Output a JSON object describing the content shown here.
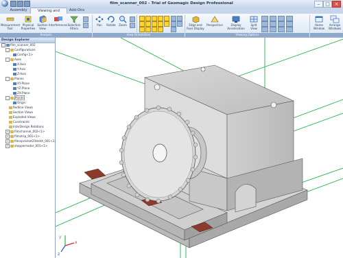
{
  "window": {
    "title": "film_scanner_002 - Trial of Geomagic Design Professional"
  },
  "tabs": [
    "Assembly",
    "Viewing and Analysis",
    "Add-Ons"
  ],
  "ribbon": {
    "groups": {
      "analysis": "Analysis",
      "view_orientation": "View Orientation",
      "viewing_options": "Viewing Options"
    },
    "buttons": {
      "measurement_tool": "Measurement Tool",
      "physical_properties": "Physical Properties",
      "section_view": "Section View",
      "interferences": "Interferences",
      "selection_filters": "Selection Filters",
      "pan": "Pan",
      "rotate": "Rotate",
      "zoom": "Zoom",
      "edge_face_display": "Edge and Face Display",
      "perspective": "Perspective",
      "display_acceleration": "Display Acceleration",
      "split_view": "Split View",
      "home_window": "Home Window",
      "arrange_windows": "Arrange Windows"
    }
  },
  "explorer": {
    "title": "Design Explorer",
    "root": "film_scanner_002",
    "items": [
      {
        "label": "Configurations",
        "level": 1,
        "toggle": "-"
      },
      {
        "label": "Config<1>",
        "level": 2,
        "toggle": ""
      },
      {
        "label": "Axes",
        "level": 1,
        "toggle": "-"
      },
      {
        "label": "X-Axis",
        "level": 2,
        "toggle": ""
      },
      {
        "label": "Y-Axis",
        "level": 2,
        "toggle": ""
      },
      {
        "label": "Z-Axis",
        "level": 2,
        "toggle": ""
      },
      {
        "label": "Planes",
        "level": 1,
        "toggle": "-"
      },
      {
        "label": "XY-Plane",
        "level": 2,
        "toggle": ""
      },
      {
        "label": "YZ-Plane",
        "level": 2,
        "toggle": ""
      },
      {
        "label": "ZX-Plane",
        "level": 2,
        "toggle": ""
      },
      {
        "label": "Points",
        "level": 1,
        "toggle": "-",
        "selected": true
      },
      {
        "label": "Origin",
        "level": 2,
        "toggle": ""
      },
      {
        "label": "Redline Views",
        "level": 1,
        "toggle": ""
      },
      {
        "label": "Section Views",
        "level": 1,
        "toggle": ""
      },
      {
        "label": "Exploded Views",
        "level": 1,
        "toggle": ""
      },
      {
        "label": "Constraints",
        "level": 1,
        "toggle": ""
      },
      {
        "label": "InterDesign Relations",
        "level": 1,
        "toggle": ""
      },
      {
        "label": "filmchannel_002<1>",
        "level": 1,
        "toggle": "+"
      },
      {
        "label": "filmstrip_001<1>",
        "level": 1,
        "toggle": "+"
      },
      {
        "label": "filmsprocket25teeth_001<1>",
        "level": 1,
        "toggle": "+"
      },
      {
        "label": "steppermotor_001<1>",
        "level": 1,
        "toggle": "+"
      }
    ]
  },
  "colors": {
    "model_gray": "#c9c9c9",
    "plane_green": "#22b14c",
    "strip_red": "#8b3a2c"
  },
  "axes": {
    "y": "y",
    "x": "x",
    "z": "z"
  }
}
